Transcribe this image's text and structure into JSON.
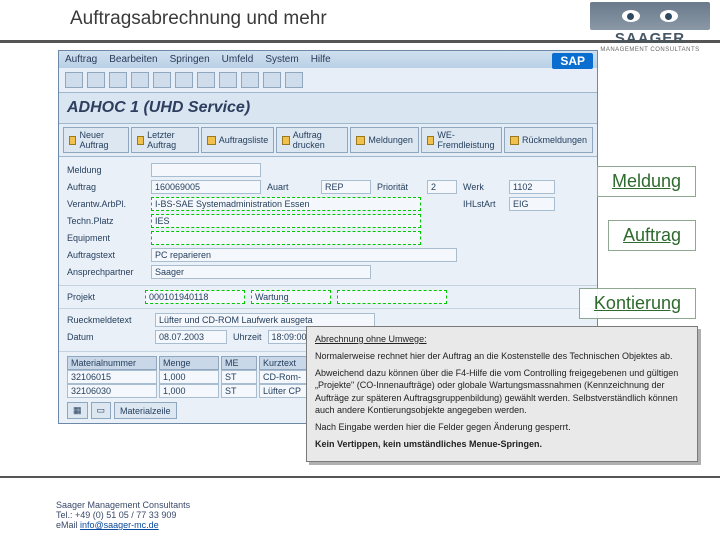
{
  "header": {
    "title": "Auftragsabrechnung und mehr"
  },
  "logo": {
    "brand": "SAAGER",
    "sub": "MANAGEMENT CONSULTANTS"
  },
  "sap": {
    "menu": [
      "Auftrag",
      "Bearbeiten",
      "Springen",
      "Umfeld",
      "System",
      "Hilfe"
    ],
    "sap_label": "SAP",
    "app_title": "ADHOC 1 (UHD Service)",
    "toolbar": [
      "Neuer Auftrag",
      "Letzter Auftrag",
      "Auftragsliste",
      "Auftrag drucken",
      "Meldungen",
      "WE-Fremdleistung",
      "Rückmeldungen"
    ],
    "fields": {
      "meldung_lbl": "Meldung",
      "meldung_val": "",
      "auftrag_lbl": "Auftrag",
      "auftrag_val": "160069005",
      "auart_lbl": "Auart",
      "auart_val": "REP",
      "prioritaet_lbl": "Priorität",
      "prioritaet_val": "2",
      "werk_lbl": "Werk",
      "werk_val": "1102",
      "verantw_lbl": "Verantw.ArbPl.",
      "verantw_val": "I-BS-SAE Systemadministration Essen",
      "ihlstart_lbl": "IHLstArt",
      "ihlstart_val": "EIG",
      "technplatz_lbl": "Techn.Platz",
      "technplatz_val": "IES",
      "equipment_lbl": "Equipment",
      "equipment_val": "",
      "auftragstext_lbl": "Auftragstext",
      "auftragstext_val": "PC reparieren",
      "ansprech_lbl": "Ansprechpartner",
      "ansprech_val": "Saager"
    },
    "projekt": {
      "lbl": "Projekt",
      "id": "000101940118",
      "wart": "Wartung"
    },
    "rueck": {
      "lbl": "Rueckmeldetext",
      "val": "Lüfter und CD-ROM Laufwerk ausgeta",
      "datum_lbl": "Datum",
      "datum_val": "08.07.2003",
      "uhr_lbl": "Uhrzeit",
      "uhr_val": "18:09:00"
    },
    "mat": {
      "head": [
        "Materialnummer",
        "Menge",
        "ME",
        "Kurztext",
        ""
      ],
      "rows": [
        [
          "32106015",
          "1,000",
          "ST",
          "CD-Rom-",
          ""
        ],
        [
          "32106030",
          "1,000",
          "ST",
          "Lüfter CP",
          ""
        ]
      ],
      "btn_add": "Materialzeile"
    }
  },
  "side": {
    "meldung": "Meldung",
    "auftrag": "Auftrag",
    "kontierung": "Kontierung"
  },
  "callout": {
    "h": "Abrechnung ohne Umwege:",
    "p1": "Normalerweise rechnet hier der Auftrag an die Kostenstelle des Technischen Objektes ab.",
    "p2": "Abweichend dazu können über die F4-Hilfe die vom Controlling freigegebenen und gültigen „Projekte\" (CO-Innenaufträge) oder globale Wartungsmassnahmen (Kennzeichnung der Aufträge zur späteren Auftragsgruppenbildung) gewählt werden. Selbstverständlich können auch andere Kontierungsobjekte angegeben werden.",
    "p3": "Nach Eingabe werden hier die Felder gegen Änderung gesperrt.",
    "p4": "Kein Vertippen, kein umständliches Menue-Springen."
  },
  "footer": {
    "l1": "Saager Management Consultants",
    "l2": "Tel.: +49 (0) 51 05 / 77 33 909",
    "l3_pre": "eMail ",
    "l3_link": "info@saager-mc.de"
  }
}
